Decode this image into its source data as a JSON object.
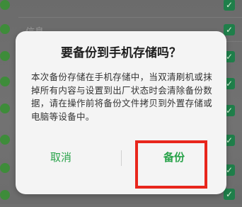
{
  "background": {
    "rows": [
      {
        "label": ""
      },
      {
        "label": "信息"
      },
      {
        "label": ""
      },
      {
        "label": ""
      },
      {
        "label": ""
      },
      {
        "label": ""
      },
      {
        "label": ""
      },
      {
        "label": ""
      }
    ],
    "check_glyph": "✓"
  },
  "dialog": {
    "title": "要备份到手机存储吗？",
    "body": "本次备份存储在手机存储中，当双清刷机或抹掉所有内容与设置到出厂状态时会清除备份数据，请在操作前将备份文件拷贝到外置存储或电脑等设备中。",
    "cancel_label": "取消",
    "backup_label": "备份"
  },
  "colors": {
    "accent": "#29a34a",
    "highlight": "#e8261c"
  }
}
